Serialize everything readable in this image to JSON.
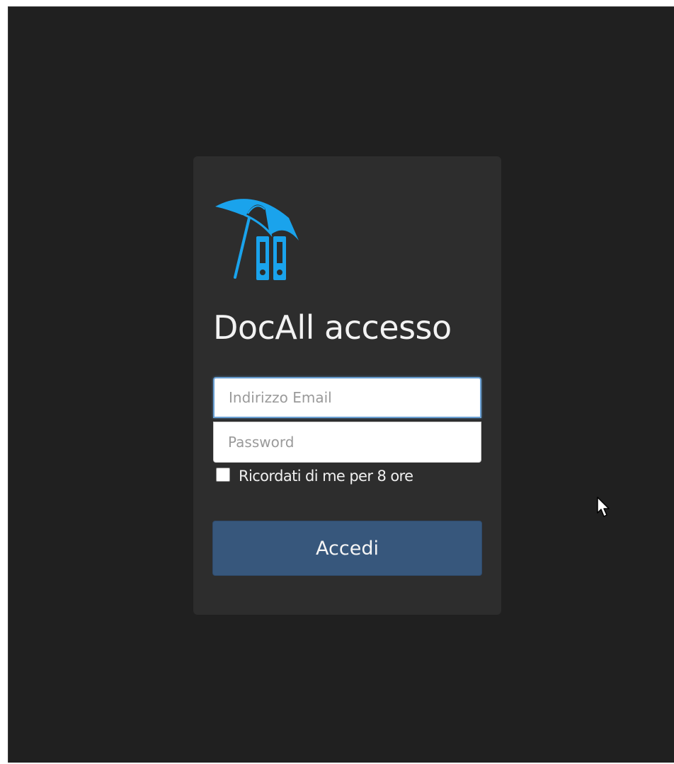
{
  "login": {
    "title": "DocAll accesso",
    "email_placeholder": "Indirizzo Email",
    "password_placeholder": "Password",
    "remember_label": "Ricordati di me per 8 ore",
    "submit_label": "Accedi"
  },
  "icons": {
    "logo": "umbrella-binders-logo",
    "cursor": "mouse-pointer-icon"
  },
  "colors": {
    "background": "#202020",
    "card": "#2d2d2d",
    "brand_blue": "#1aa3ec",
    "button": "#37577c",
    "focus_border": "#6aa0d4"
  }
}
